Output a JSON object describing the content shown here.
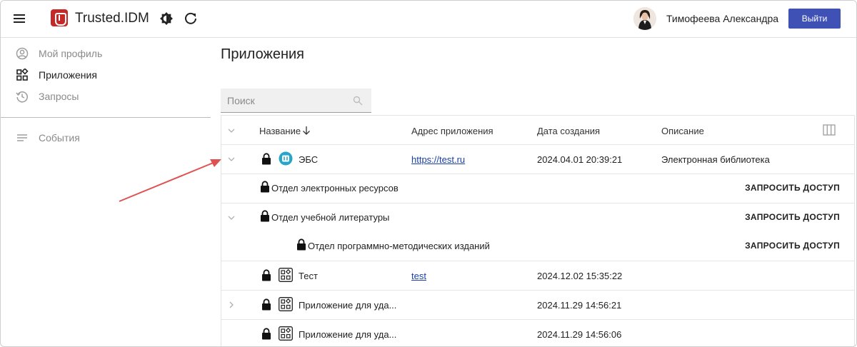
{
  "header": {
    "app_title": "Trusted.IDM",
    "user_name": "Тимофеева Александра",
    "logout_label": "Выйти"
  },
  "sidebar": {
    "items": [
      {
        "label": "Мой профиль",
        "icon": "user-circle-icon"
      },
      {
        "label": "Приложения",
        "icon": "apps-grid-icon"
      },
      {
        "label": "Запросы",
        "icon": "history-icon"
      },
      {
        "label": "События",
        "icon": "list-icon"
      }
    ]
  },
  "main": {
    "title": "Приложения",
    "search_placeholder": "Поиск",
    "columns": {
      "name": "Название",
      "address": "Адрес приложения",
      "created": "Дата создания",
      "description": "Описание"
    },
    "rows": [
      {
        "name": "ЭБС",
        "address": "https://test.ru",
        "created": "2024.04.01 20:39:21",
        "description": "Электронная библиотека"
      },
      {
        "name": "Отдел электронных ресурсов",
        "action": "ЗАПРОСИТЬ ДОСТУП"
      },
      {
        "name": "Отдел учебной литературы",
        "action": "ЗАПРОСИТЬ ДОСТУП"
      },
      {
        "name": "Отдел программно-методических изданий",
        "action": "ЗАПРОСИТЬ ДОСТУП"
      },
      {
        "name": "Тест",
        "address": "test",
        "created": "2024.12.02 15:35:22"
      },
      {
        "name": "Приложение для уда...",
        "created": "2024.11.29 14:56:21"
      },
      {
        "name": "Приложение для уда...",
        "created": "2024.11.29 14:56:06"
      }
    ]
  },
  "colors": {
    "accent": "#3f51b5",
    "logo": "#c62828",
    "annotation_arrow": "#e05252",
    "ebs_badge": "#26a7c9"
  }
}
